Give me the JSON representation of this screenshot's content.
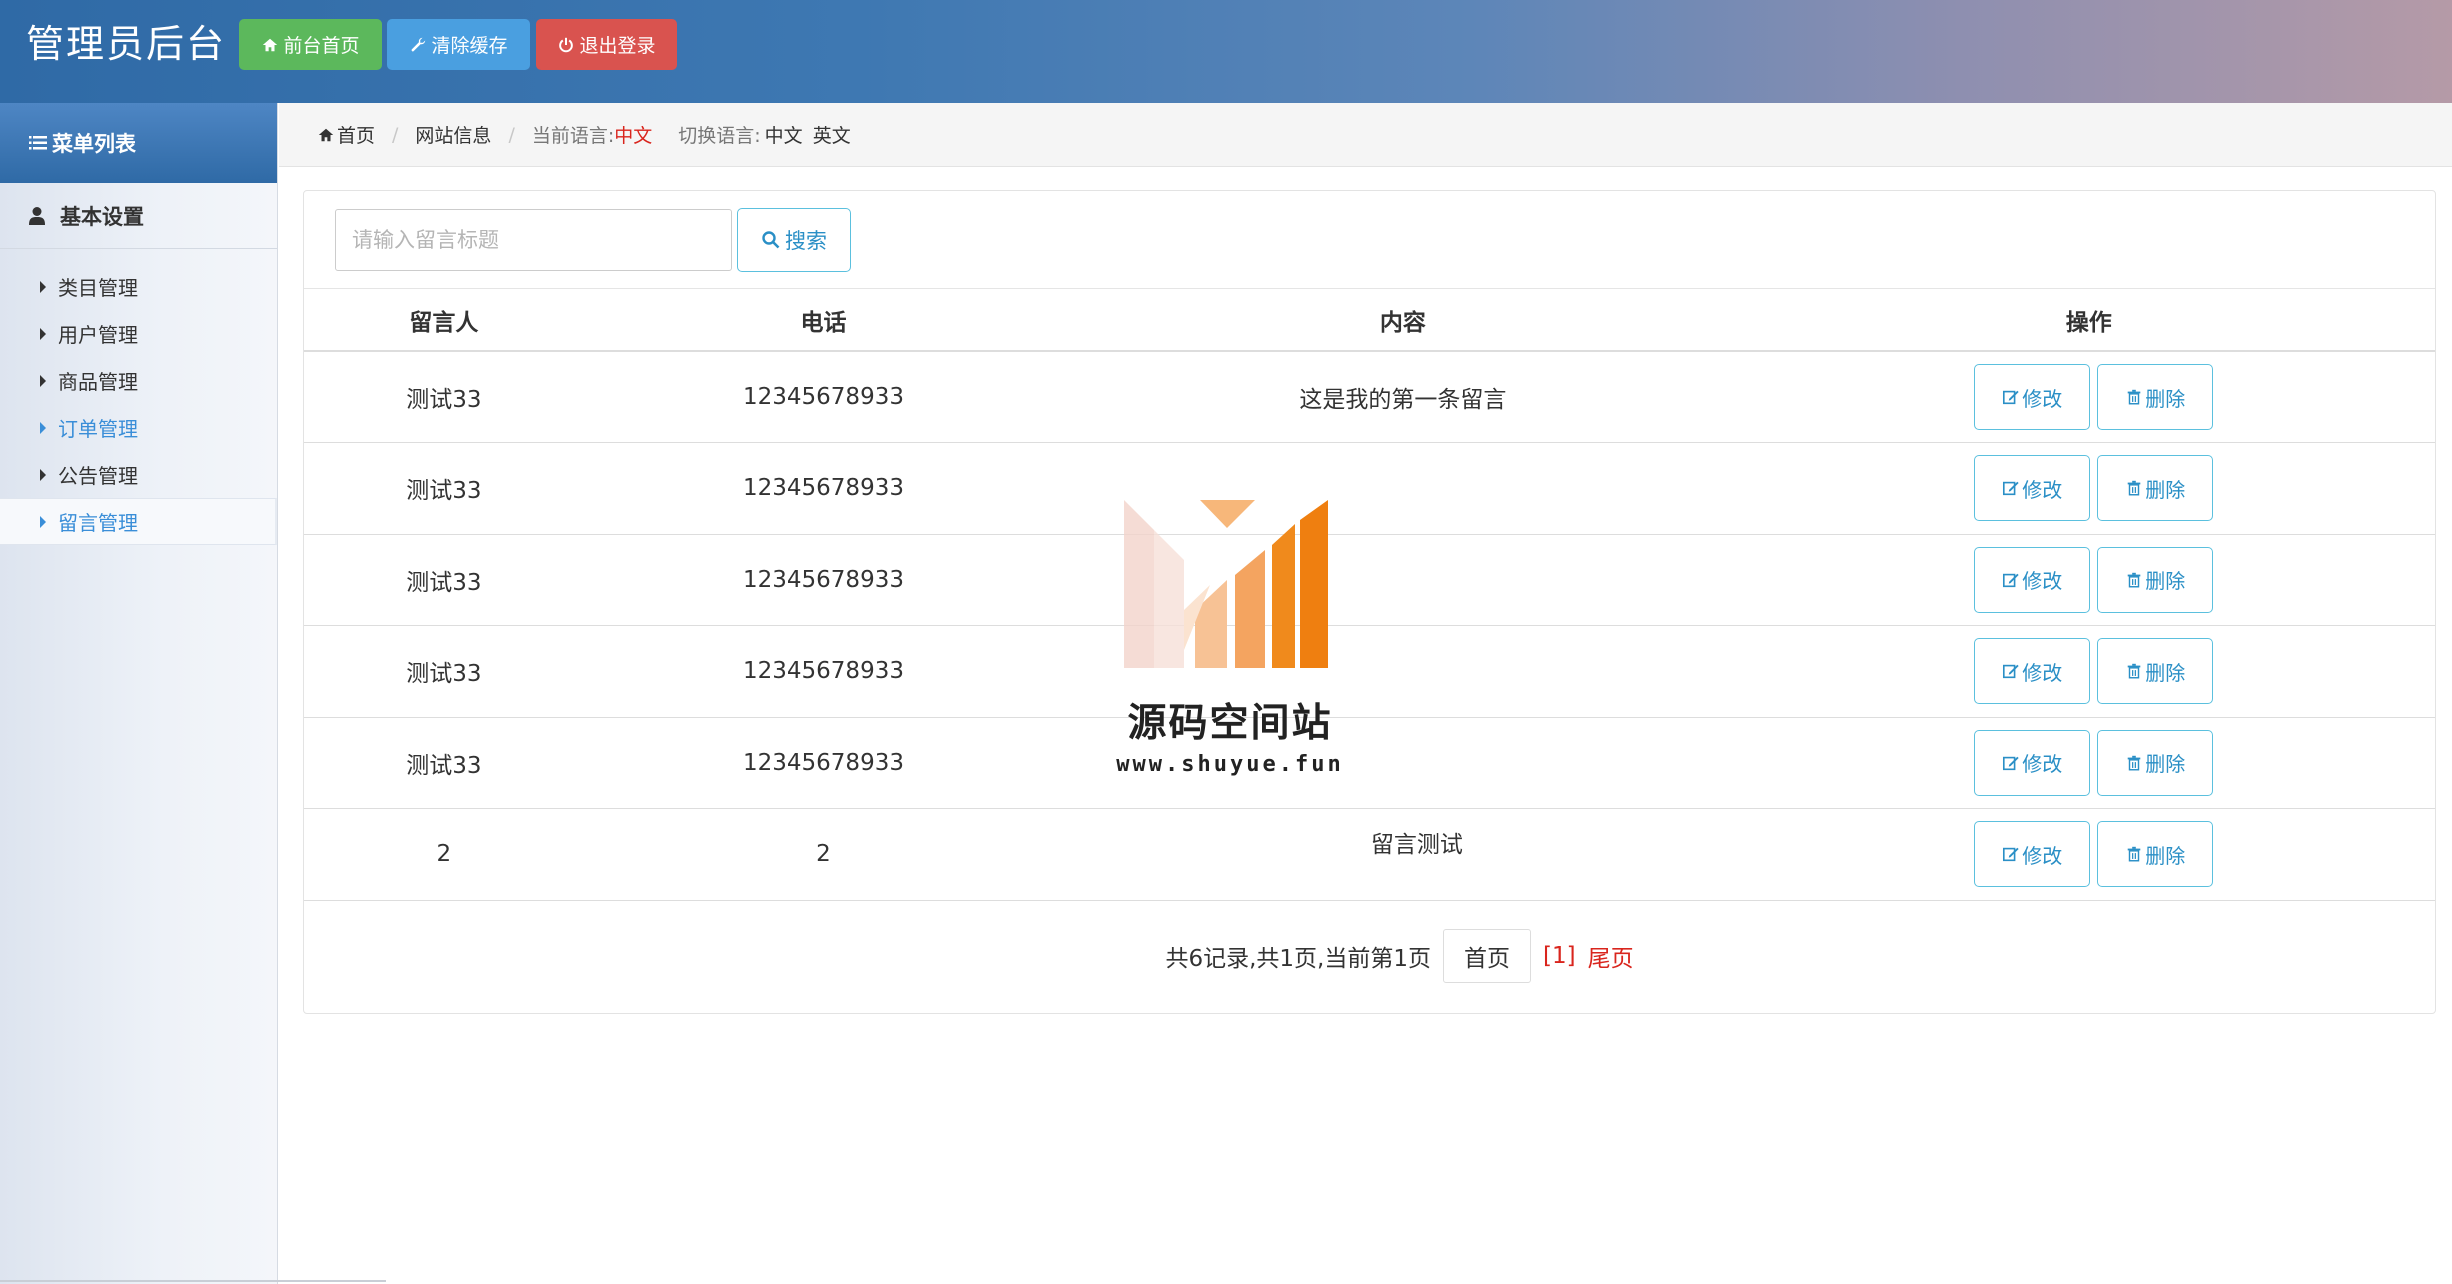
{
  "header": {
    "title": "管理员后台",
    "buttons": {
      "home": "前台首页",
      "clear_cache": "清除缓存",
      "logout": "退出登录"
    }
  },
  "sidebar": {
    "heading": "菜单列表",
    "group": "基本设置",
    "items": [
      {
        "label": "类目管理"
      },
      {
        "label": "用户管理"
      },
      {
        "label": "商品管理"
      },
      {
        "label": "订单管理"
      },
      {
        "label": "公告管理"
      },
      {
        "label": "留言管理"
      }
    ]
  },
  "breadcrumb": {
    "home": "首页",
    "site_info": "网站信息",
    "current_lang_label": "当前语言:",
    "current_lang": "中文",
    "switch_label": "切换语言:",
    "lang_zh": "中文",
    "lang_en": "英文"
  },
  "search": {
    "placeholder": "请输入留言标题",
    "button": "搜索"
  },
  "table": {
    "headers": [
      "留言人",
      "电话",
      "内容",
      "操作"
    ],
    "rows": [
      {
        "name": "测试33",
        "phone": "12345678933",
        "content": "这是我的第一条留言"
      },
      {
        "name": "测试33",
        "phone": "12345678933",
        "content": ""
      },
      {
        "name": "测试33",
        "phone": "12345678933",
        "content": ""
      },
      {
        "name": "测试33",
        "phone": "12345678933",
        "content": ""
      },
      {
        "name": "测试33",
        "phone": "12345678933",
        "content": ""
      },
      {
        "name": "2",
        "phone": "2",
        "content": "留言测试"
      }
    ],
    "edit_label": "修改",
    "delete_label": "删除"
  },
  "pager": {
    "summary": "共6记录,共1页,当前第1页",
    "first": "首页",
    "current": "[1]",
    "last": "尾页"
  },
  "watermark": {
    "name": "源码空间站",
    "url": "www.shuyue.fun"
  },
  "colors": {
    "primary": "#2f6aa6",
    "success": "#5cb85c",
    "info": "#4a9fe0",
    "danger": "#d9534f",
    "link": "#2a8fc6"
  }
}
